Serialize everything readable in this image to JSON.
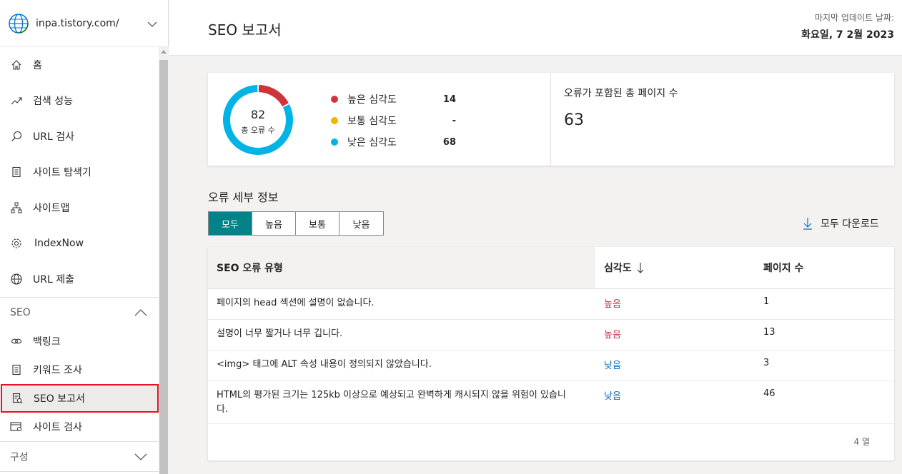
{
  "site": {
    "url": "inpa.tistory.com/"
  },
  "nav": {
    "items": [
      {
        "label": "홈",
        "icon": "home-icon"
      },
      {
        "label": "검색 성능",
        "icon": "trend-icon"
      },
      {
        "label": "URL 검사",
        "icon": "search-icon"
      },
      {
        "label": "사이트 탐색기",
        "icon": "document-icon"
      },
      {
        "label": "사이트맵",
        "icon": "sitemap-icon"
      },
      {
        "label": "IndexNow",
        "icon": "gear-icon"
      },
      {
        "label": "URL 제출",
        "icon": "globe-icon"
      }
    ],
    "seo_section": "SEO",
    "seo_items": [
      {
        "label": "백링크",
        "icon": "link-icon"
      },
      {
        "label": "키워드 조사",
        "icon": "document-icon"
      },
      {
        "label": "SEO 보고서",
        "icon": "report-icon"
      },
      {
        "label": "사이트 검사",
        "icon": "site-scan-icon"
      }
    ],
    "config_section": "구성"
  },
  "header": {
    "title": "SEO 보고서",
    "updated_label": "마지막 업데이트 날짜:",
    "updated_date": "화요일, 7 2월 2023"
  },
  "summary": {
    "total_errors": "82",
    "total_errors_label": "총 오류 수",
    "legend": [
      {
        "label": "높은 심각도",
        "value": "14",
        "color": "#d13438"
      },
      {
        "label": "보통 심각도",
        "value": "-",
        "color": "#f2b400"
      },
      {
        "label": "낮은 심각도",
        "value": "68",
        "color": "#00b4e6"
      }
    ],
    "pages_label": "오류가 포함된 총 페이지 수",
    "pages_value": "63"
  },
  "details": {
    "title": "오류 세부 정보",
    "tabs": [
      "모두",
      "높음",
      "보통",
      "낮음"
    ],
    "download_label": "모두 다운로드",
    "columns": [
      "SEO 오류 유형",
      "심각도",
      "페이지 수"
    ],
    "rows": [
      {
        "type": "페이지의 head 섹션에 설명이 없습니다.",
        "severity": "높음",
        "pages": "1"
      },
      {
        "type": "설명이 너무 짧거나 너무 깁니다.",
        "severity": "높음",
        "pages": "13"
      },
      {
        "type": "<img> 태그에 ALT 속성 내용이 정의되지 않았습니다.",
        "severity": "낮음",
        "pages": "3"
      },
      {
        "type": "HTML의 평가된 크기는 125kb 이상으로 예상되고 완벽하게 캐시되지 않을 위험이 있습니다.",
        "severity": "낮음",
        "pages": "46"
      }
    ],
    "row_count": "4 열"
  },
  "colors": {
    "accent": "#038387",
    "high": "#c4314b",
    "low": "#0f6cbd",
    "highlight_border": "#e81123"
  }
}
